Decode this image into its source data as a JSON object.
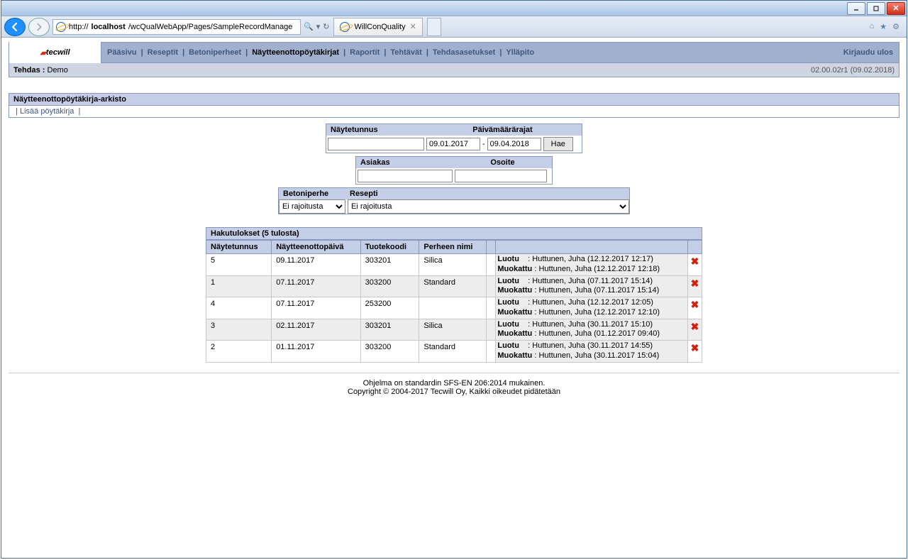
{
  "browser": {
    "url_prefix": "http://",
    "url_host": "localhost",
    "url_path": "/wcQualWebApp/Pages/SampleRecordManage",
    "tab_title": "WillConQuality"
  },
  "nav": {
    "items": [
      "Pääsivu",
      "Reseptit",
      "Betoniperheet",
      "Näytteenottopöytäkirjat",
      "Raportit",
      "Tehtävät",
      "Tehdasasetukset",
      "Ylläpito"
    ],
    "active_index": 3,
    "logout": "Kirjaudu ulos"
  },
  "subbar": {
    "tehdas_label": "Tehdas :",
    "tehdas_value": "Demo",
    "version": "02.00.02r1 (09.02.2018)"
  },
  "page": {
    "section_title": "Näytteenottopöytäkirja-arkisto",
    "add_link": "Lisää pöytäkirja"
  },
  "search": {
    "naytetunnus_label": "Näytetunnus",
    "paivamaararajat_label": "Päivämäärärajat",
    "date_from": "09.01.2017",
    "date_to": "09.04.2018",
    "hae": "Hae",
    "asiakas_label": "Asiakas",
    "osoite_label": "Osoite",
    "betoniperhe_label": "Betoniperhe",
    "resepti_label": "Resepti",
    "no_restriction": "Ei rajoitusta"
  },
  "results": {
    "header": "Hakutulokset  (5 tulosta)",
    "cols": [
      "Näytetunnus",
      "Näytteenottopäivä",
      "Tuotekoodi",
      "Perheen nimi"
    ],
    "luotu_label": "Luotu",
    "muokattu_label": "Muokattu",
    "rows": [
      {
        "id": "5",
        "date": "09.11.2017",
        "code": "303201",
        "family": "Silica",
        "created": "Huttunen, Juha (12.12.2017 12:17)",
        "modified": "Huttunen, Juha (12.12.2017 12:18)"
      },
      {
        "id": "1",
        "date": "07.11.2017",
        "code": "303200",
        "family": "Standard",
        "created": "Huttunen, Juha (07.11.2017 15:14)",
        "modified": "Huttunen, Juha (07.11.2017 15:14)"
      },
      {
        "id": "4",
        "date": "07.11.2017",
        "code": "253200",
        "family": "",
        "created": "Huttunen, Juha (12.12.2017 12:05)",
        "modified": "Huttunen, Juha (12.12.2017 12:10)"
      },
      {
        "id": "3",
        "date": "02.11.2017",
        "code": "303201",
        "family": "Silica",
        "created": "Huttunen, Juha (30.11.2017 15:10)",
        "modified": "Huttunen, Juha (01.12.2017 09:40)"
      },
      {
        "id": "2",
        "date": "01.11.2017",
        "code": "303200",
        "family": "Standard",
        "created": "Huttunen, Juha (30.11.2017 14:55)",
        "modified": "Huttunen, Juha (30.11.2017 15:04)"
      }
    ]
  },
  "footer": {
    "line1": "Ohjelma on standardin SFS-EN 206:2014 mukainen.",
    "line2": "Copyright © 2004-2017 Tecwill Oy, Kaikki oikeudet pidätetään"
  },
  "logo_text": "tecwill"
}
